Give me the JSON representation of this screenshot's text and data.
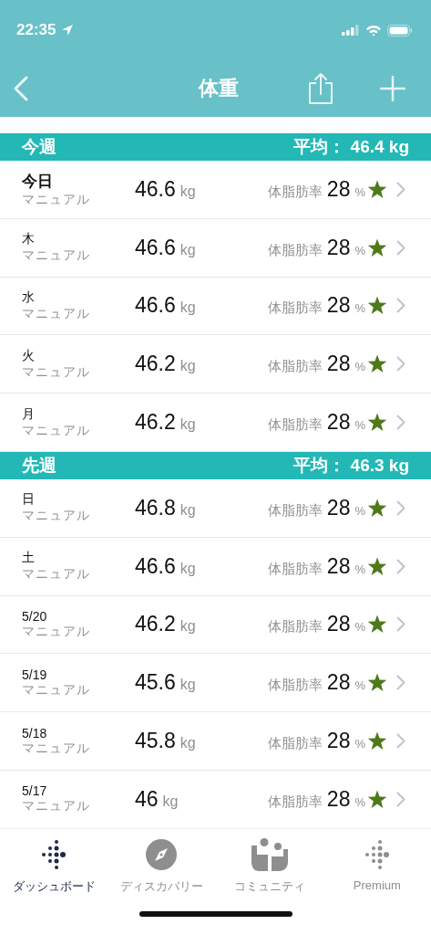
{
  "status_bar": {
    "time": "22:35"
  },
  "nav": {
    "title": "体重"
  },
  "sections": [
    {
      "title": "今週",
      "average": "平均： 46.4 kg",
      "rows": [
        {
          "day": "今日",
          "today": true,
          "source": "マニュアル",
          "weight": "46.6",
          "unit": "kg",
          "fat_label": "体脂肪率",
          "fat": "28",
          "fat_unit": "%"
        },
        {
          "day": "木",
          "today": false,
          "source": "マニュアル",
          "weight": "46.6",
          "unit": "kg",
          "fat_label": "体脂肪率",
          "fat": "28",
          "fat_unit": "%"
        },
        {
          "day": "水",
          "today": false,
          "source": "マニュアル",
          "weight": "46.6",
          "unit": "kg",
          "fat_label": "体脂肪率",
          "fat": "28",
          "fat_unit": "%"
        },
        {
          "day": "火",
          "today": false,
          "source": "マニュアル",
          "weight": "46.2",
          "unit": "kg",
          "fat_label": "体脂肪率",
          "fat": "28",
          "fat_unit": "%"
        },
        {
          "day": "月",
          "today": false,
          "source": "マニュアル",
          "weight": "46.2",
          "unit": "kg",
          "fat_label": "体脂肪率",
          "fat": "28",
          "fat_unit": "%"
        }
      ]
    },
    {
      "title": "先週",
      "average": "平均： 46.3 kg",
      "rows": [
        {
          "day": "日",
          "today": false,
          "source": "マニュアル",
          "weight": "46.8",
          "unit": "kg",
          "fat_label": "体脂肪率",
          "fat": "28",
          "fat_unit": "%"
        },
        {
          "day": "土",
          "today": false,
          "source": "マニュアル",
          "weight": "46.6",
          "unit": "kg",
          "fat_label": "体脂肪率",
          "fat": "28",
          "fat_unit": "%"
        },
        {
          "day": "5/20",
          "today": false,
          "source": "マニュアル",
          "weight": "46.2",
          "unit": "kg",
          "fat_label": "体脂肪率",
          "fat": "28",
          "fat_unit": "%"
        },
        {
          "day": "5/19",
          "today": false,
          "source": "マニュアル",
          "weight": "45.6",
          "unit": "kg",
          "fat_label": "体脂肪率",
          "fat": "28",
          "fat_unit": "%"
        },
        {
          "day": "5/18",
          "today": false,
          "source": "マニュアル",
          "weight": "45.8",
          "unit": "kg",
          "fat_label": "体脂肪率",
          "fat": "28",
          "fat_unit": "%"
        },
        {
          "day": "5/17",
          "today": false,
          "source": "マニュアル",
          "weight": "46",
          "unit": "kg",
          "fat_label": "体脂肪率",
          "fat": "28",
          "fat_unit": "%"
        }
      ]
    }
  ],
  "tab_bar": [
    {
      "label": "ダッシュボード",
      "kind": "dots",
      "selected": true
    },
    {
      "label": "ディスカバリー",
      "kind": "compass",
      "selected": false
    },
    {
      "label": "コミュニティ",
      "kind": "people",
      "selected": false
    },
    {
      "label": "Premium",
      "kind": "dots",
      "selected": false
    }
  ]
}
